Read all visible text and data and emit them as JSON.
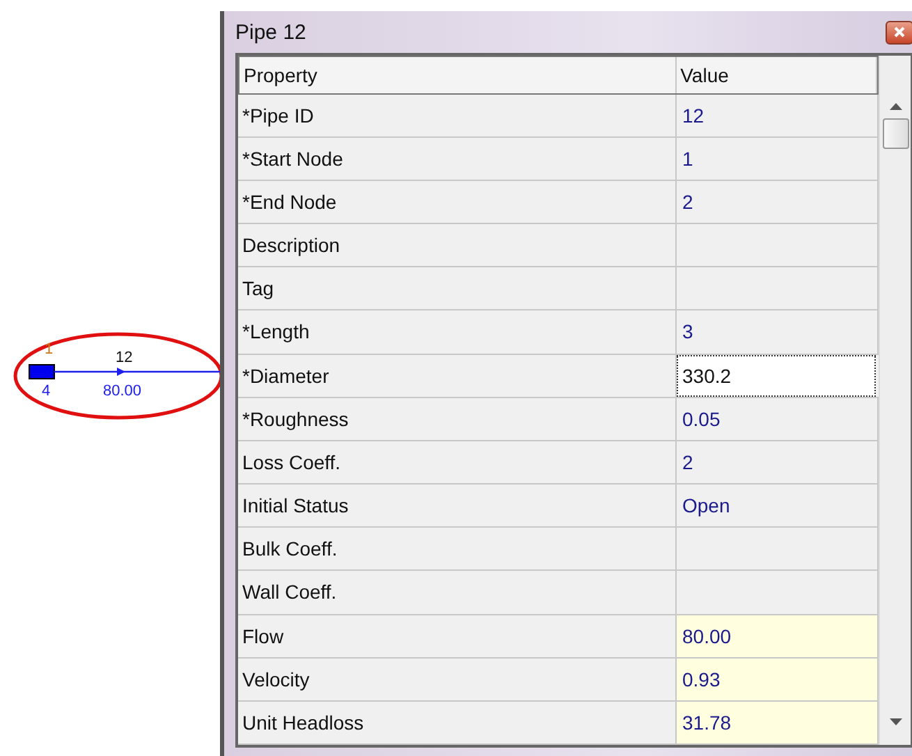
{
  "map": {
    "node_id": "1",
    "node_value": "4",
    "pipe_id": "12",
    "pipe_flow": "80.00"
  },
  "window": {
    "title": "Pipe 12"
  },
  "table": {
    "columns": [
      "Property",
      "Value"
    ],
    "rows": [
      {
        "property": "*Pipe ID",
        "value": "12",
        "kind": "param"
      },
      {
        "property": "*Start Node",
        "value": "1",
        "kind": "param"
      },
      {
        "property": "*End Node",
        "value": "2",
        "kind": "param"
      },
      {
        "property": "Description",
        "kind": "param"
      },
      {
        "property": "Tag",
        "kind": "param"
      },
      {
        "property": "*Length",
        "value": "3",
        "kind": "param"
      },
      {
        "property": "*Diameter",
        "value": "330.2",
        "kind": "edit"
      },
      {
        "property": "*Roughness",
        "value": "0.05",
        "kind": "param"
      },
      {
        "property": "Loss Coeff.",
        "value": "2",
        "kind": "param"
      },
      {
        "property": "Initial Status",
        "value": "Open",
        "kind": "param"
      },
      {
        "property": "Bulk Coeff.",
        "kind": "param"
      },
      {
        "property": "Wall Coeff.",
        "kind": "param"
      },
      {
        "property": "Flow",
        "value": "80.00",
        "kind": "result"
      },
      {
        "property": "Velocity",
        "value": "0.93",
        "kind": "result"
      },
      {
        "property": "Unit Headloss",
        "value": "31.78",
        "kind": "result"
      }
    ]
  }
}
